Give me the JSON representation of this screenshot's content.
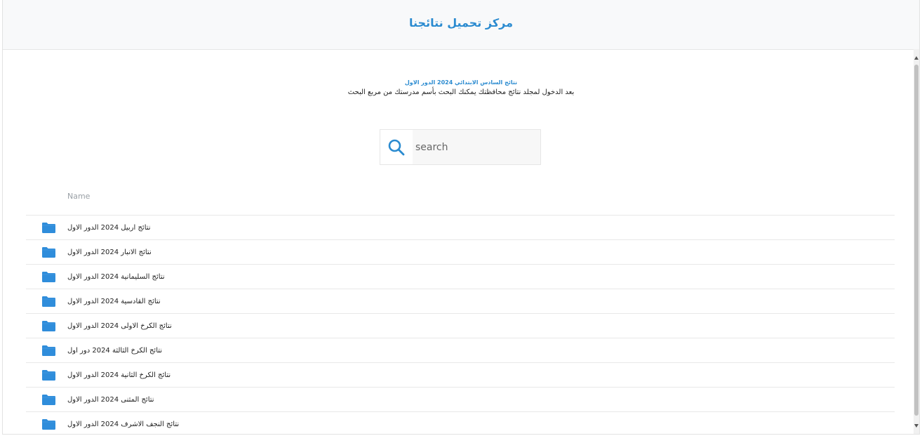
{
  "header": {
    "title": "مركز تحميل نتائجنا"
  },
  "intro": {
    "subtitle": "نتائج السادس الابتدائي 2024 الدور الاول",
    "description": "بعد الدخول لمجلد نتائج محافظتك يمكنك البحث بأسم مدرستك من مربع البحث"
  },
  "search": {
    "placeholder": "search",
    "icon": "search-icon",
    "icon_color": "#2b8bd0"
  },
  "table": {
    "column_name": "Name",
    "folder_color": "#2f8ddb",
    "rows": [
      {
        "label": "نتائج اربيل 2024 الدور الاول"
      },
      {
        "label": "نتائج الانبار 2024 الدور الاول"
      },
      {
        "label": "نتائج السليمانية 2024 الدور الاول"
      },
      {
        "label": "نتائج القادسية 2024 الدور الاول"
      },
      {
        "label": "نتائج الكرخ الاولى 2024 الدور الاول"
      },
      {
        "label": "نتائج الكرخ الثالثة 2024 دور اول"
      },
      {
        "label": "نتائج الكرخ الثانية 2024 الدور الاول"
      },
      {
        "label": "نتائج المثنى 2024 الدور الاول"
      },
      {
        "label": "نتائج النجف الاشرف 2024 الدور الاول"
      }
    ]
  }
}
